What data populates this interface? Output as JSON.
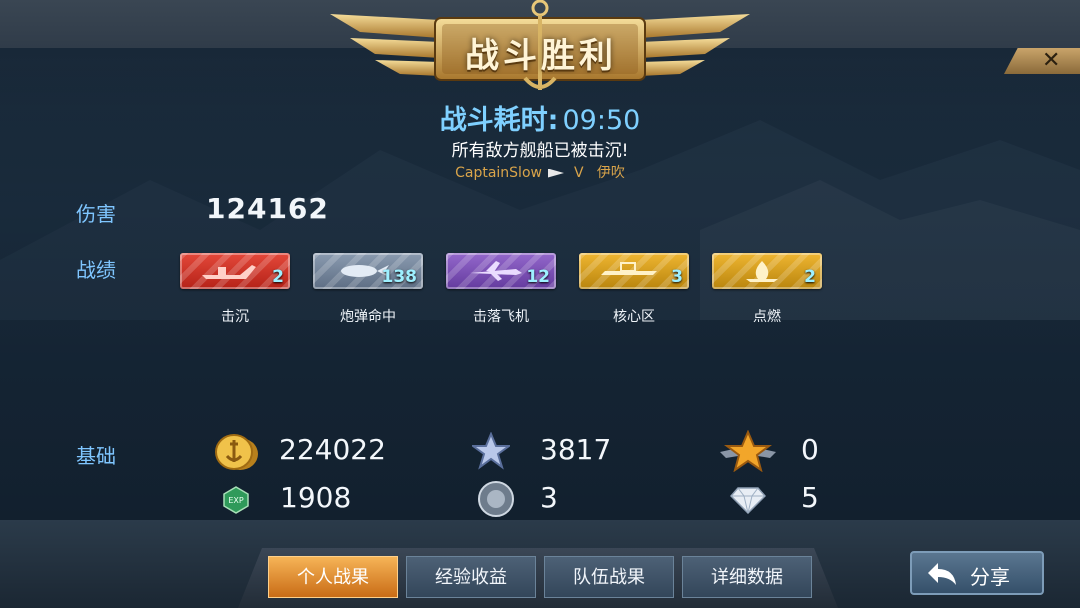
{
  "header": {
    "title": "战斗胜利",
    "close_label": "✕",
    "battle_time_label": "战斗耗时:",
    "battle_time_value": "09:50",
    "result_message": "所有敌方舰船已被击沉!",
    "player_name": "CaptainSlow",
    "player_tier": "V",
    "player_ship": "伊吹"
  },
  "stats": {
    "damage_label": "伤害",
    "damage_value": "124162",
    "achievements_label": "战绩",
    "achievements": [
      {
        "caption": "击沉",
        "count": "2",
        "icon": "ship-sink-icon",
        "color": "#d8352a"
      },
      {
        "caption": "炮弹命中",
        "count": "138",
        "icon": "shell-hit-icon",
        "color": "#6e7f95"
      },
      {
        "caption": "击落飞机",
        "count": "12",
        "icon": "plane-shotdown-icon",
        "color": "#7a4fb3"
      },
      {
        "caption": "核心区",
        "count": "3",
        "icon": "citadel-icon",
        "color": "#d79b17"
      },
      {
        "caption": "点燃",
        "count": "2",
        "icon": "fire-icon",
        "color": "#d79b17"
      }
    ],
    "base_label": "基础",
    "resources": {
      "silver": "224022",
      "stars": "3817",
      "gold_star": "0",
      "exp": "1908",
      "medal": "3",
      "diamond": "5"
    }
  },
  "tabs": [
    {
      "label": "个人战果",
      "active": true
    },
    {
      "label": "经验收益",
      "active": false
    },
    {
      "label": "队伍战果",
      "active": false
    },
    {
      "label": "详细数据",
      "active": false
    }
  ],
  "share_label": "分享"
}
